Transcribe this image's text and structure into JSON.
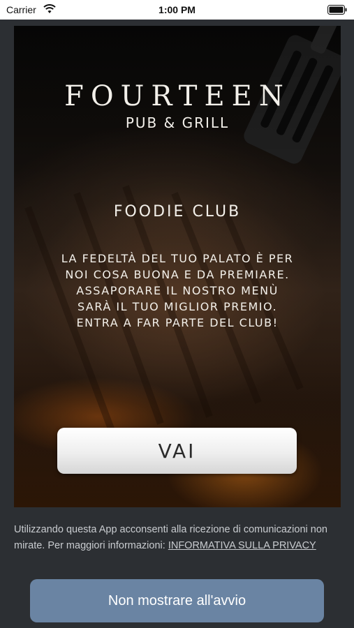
{
  "status_bar": {
    "carrier": "Carrier",
    "time": "1:00 PM"
  },
  "hero": {
    "brand_name": "FOURTEEN",
    "brand_sub": "PUB & GRILL",
    "club_title": "FOODIE CLUB",
    "club_text_lines": [
      "LA FEDELTÀ DEL TUO PALATO È PER",
      "NOI COSA BUONA E DA PREMIARE.",
      "ASSAPORARE IL NOSTRO MENÙ",
      "SARÀ IL TUO MIGLIOR PREMIO.",
      "ENTRA A FAR PARTE DEL CLUB!"
    ],
    "cta_label": "VAI"
  },
  "notice": {
    "text": "Utilizzando questa App acconsenti alla ricezione di comunicazioni non mirate. Per maggiori informazioni: ",
    "link_label": "INFORMATIVA SULLA PRIVACY"
  },
  "footer": {
    "no_show_label": "Non mostrare all'avvio"
  },
  "icons": [
    "wifi-icon",
    "battery-icon"
  ],
  "colors": {
    "background": "#2c2f33",
    "button_blue": "#6a84a3",
    "text_light": "#f3f0ea"
  }
}
